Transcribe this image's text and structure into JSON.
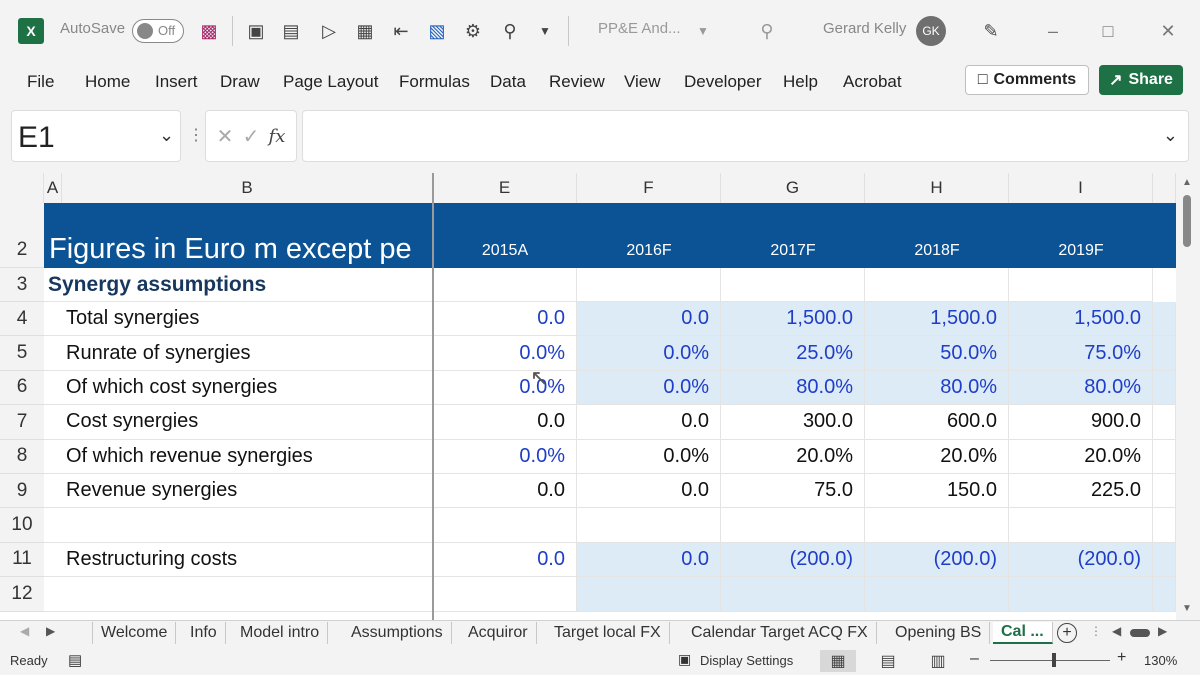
{
  "titlebar": {
    "app_logo": "X",
    "autosave_label": "AutoSave",
    "autosave_state": "Off",
    "filename": "PP&E And...",
    "user_name": "Gerard Kelly",
    "user_initials": "GK"
  },
  "ribbon": {
    "tabs": [
      "File",
      "Home",
      "Insert",
      "Draw",
      "Page Layout",
      "Formulas",
      "Data",
      "Review",
      "View",
      "Developer",
      "Help",
      "Acrobat"
    ],
    "comments_label": "Comments",
    "share_label": "Share"
  },
  "formula_bar": {
    "name_box": "E1",
    "fx_label": "fx",
    "formula": ""
  },
  "columns": [
    "A",
    "B",
    "E",
    "F",
    "G",
    "H",
    "I"
  ],
  "row_numbers": [
    "2",
    "3",
    "4",
    "5",
    "6",
    "7",
    "8",
    "9",
    "10",
    "11",
    "12"
  ],
  "banner": {
    "title": "Figures in Euro m except pe",
    "years": [
      "2015A",
      "2016F",
      "2017F",
      "2018F",
      "2019F"
    ]
  },
  "section_heading": "Synergy assumptions",
  "rows": [
    {
      "label": "Total synergies",
      "values": [
        "0.0",
        "0.0",
        "1,500.0",
        "1,500.0",
        "1,500.0"
      ]
    },
    {
      "label": "Runrate of synergies",
      "values": [
        "0.0%",
        "0.0%",
        "25.0%",
        "50.0%",
        "75.0%"
      ]
    },
    {
      "label": "Of which cost synergies",
      "values": [
        "0.0%",
        "0.0%",
        "80.0%",
        "80.0%",
        "80.0%"
      ]
    },
    {
      "label": "Cost synergies",
      "values": [
        "0.0",
        "0.0",
        "300.0",
        "600.0",
        "900.0"
      ]
    },
    {
      "label": "Of which revenue synergies",
      "values": [
        "0.0%",
        "0.0%",
        "20.0%",
        "20.0%",
        "20.0%"
      ]
    },
    {
      "label": "Revenue synergies",
      "values": [
        "0.0",
        "0.0",
        "75.0",
        "150.0",
        "225.0"
      ]
    },
    {
      "label": "",
      "values": [
        "",
        "",
        "",
        "",
        ""
      ]
    },
    {
      "label": "Restructuring costs",
      "values": [
        "0.0",
        "0.0",
        "(200.0)",
        "(200.0)",
        "(200.0)"
      ]
    },
    {
      "label": "",
      "values": [
        "",
        "",
        "",
        "",
        ""
      ]
    }
  ],
  "sheet_tabs": [
    "Welcome",
    "Info",
    "Model intro",
    "Assumptions",
    "Acquiror",
    "Target local FX",
    "Calendar Target ACQ FX",
    "Opening BS",
    "Cal ..."
  ],
  "statusbar": {
    "ready": "Ready",
    "display_settings": "Display Settings",
    "zoom": "130%"
  },
  "colors": {
    "banner": "#0b5394",
    "input_blue": "#1f3ec7",
    "shade": "#ddebf7",
    "excel_green": "#1e7145"
  }
}
